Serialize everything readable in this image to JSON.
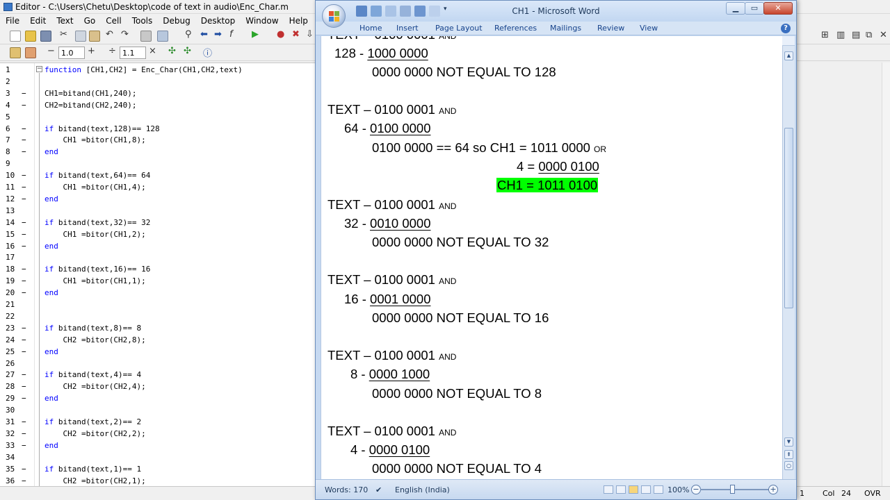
{
  "matlab": {
    "title": "Editor - C:\\Users\\Chetu\\Desktop\\code of text in audio\\Enc_Char.m",
    "menu": [
      "File",
      "Edit",
      "Text",
      "Go",
      "Cell",
      "Tools",
      "Debug",
      "Desktop",
      "Window",
      "Help"
    ],
    "toolbar2": {
      "minus": "−",
      "value1": "1.0",
      "plus": "+",
      "div": "÷",
      "value2": "1.1",
      "times": "×"
    },
    "fold_symbol": "−",
    "lines": [
      {
        "n": "1",
        "dash": "",
        "code": "function [CH1,CH2] = Enc_Char(CH1,CH2,text)"
      },
      {
        "n": "2",
        "dash": "",
        "code": ""
      },
      {
        "n": "3",
        "dash": "−",
        "code": "CH1=bitand(CH1,240);"
      },
      {
        "n": "4",
        "dash": "−",
        "code": "CH2=bitand(CH2,240);"
      },
      {
        "n": "5",
        "dash": "",
        "code": ""
      },
      {
        "n": "6",
        "dash": "−",
        "code": "if bitand(text,128)== 128"
      },
      {
        "n": "7",
        "dash": "−",
        "code": "    CH1 =bitor(CH1,8);"
      },
      {
        "n": "8",
        "dash": "−",
        "code": "end"
      },
      {
        "n": "9",
        "dash": "",
        "code": ""
      },
      {
        "n": "10",
        "dash": "−",
        "code": "if bitand(text,64)== 64"
      },
      {
        "n": "11",
        "dash": "−",
        "code": "    CH1 =bitor(CH1,4);"
      },
      {
        "n": "12",
        "dash": "−",
        "code": "end"
      },
      {
        "n": "13",
        "dash": "",
        "code": ""
      },
      {
        "n": "14",
        "dash": "−",
        "code": "if bitand(text,32)== 32"
      },
      {
        "n": "15",
        "dash": "−",
        "code": "    CH1 =bitor(CH1,2);"
      },
      {
        "n": "16",
        "dash": "−",
        "code": "end"
      },
      {
        "n": "17",
        "dash": "",
        "code": ""
      },
      {
        "n": "18",
        "dash": "−",
        "code": "if bitand(text,16)== 16"
      },
      {
        "n": "19",
        "dash": "−",
        "code": "    CH1 =bitor(CH1,1);"
      },
      {
        "n": "20",
        "dash": "−",
        "code": "end"
      },
      {
        "n": "21",
        "dash": "",
        "code": ""
      },
      {
        "n": "22",
        "dash": "",
        "code": ""
      },
      {
        "n": "23",
        "dash": "−",
        "code": "if bitand(text,8)== 8"
      },
      {
        "n": "24",
        "dash": "−",
        "code": "    CH2 =bitor(CH2,8);"
      },
      {
        "n": "25",
        "dash": "−",
        "code": "end"
      },
      {
        "n": "26",
        "dash": "",
        "code": ""
      },
      {
        "n": "27",
        "dash": "−",
        "code": "if bitand(text,4)== 4"
      },
      {
        "n": "28",
        "dash": "−",
        "code": "    CH2 =bitor(CH2,4);"
      },
      {
        "n": "29",
        "dash": "−",
        "code": "end"
      },
      {
        "n": "30",
        "dash": "",
        "code": ""
      },
      {
        "n": "31",
        "dash": "−",
        "code": "if bitand(text,2)== 2"
      },
      {
        "n": "32",
        "dash": "−",
        "code": "    CH2 =bitor(CH2,2);"
      },
      {
        "n": "33",
        "dash": "−",
        "code": "end"
      },
      {
        "n": "34",
        "dash": "",
        "code": ""
      },
      {
        "n": "35",
        "dash": "−",
        "code": "if bitand(text,1)== 1"
      },
      {
        "n": "36",
        "dash": "−",
        "code": "    CH2 =bitor(CH2,1);"
      }
    ],
    "status": {
      "ln_value": "1",
      "col_label": "Col",
      "col_value": "24",
      "ovr": "OVR"
    }
  },
  "word": {
    "title": "CH1 - Microsoft Word",
    "controls": {
      "minimize": "▁",
      "maximize": "▭",
      "close": "✕"
    },
    "tabs": [
      "Home",
      "Insert",
      "Page Layout",
      "References",
      "Mailings",
      "Review",
      "View"
    ],
    "help": "?",
    "doc": {
      "line128": {
        "num": "128 - ",
        "bits": "1000 0000"
      },
      "res128": "0000 0000 NOT EQUAL TO 128",
      "text_label": "TEXT – 0100 0001 ",
      "and_label": "AND",
      "or_label": "OR",
      "line64": {
        "num": "64 - ",
        "bits": "0100 0000"
      },
      "res64": "0100 0000 == 64 so CH1 = 1011 0000 ",
      "four_eq": "4 = ",
      "four_bits": "0000 0100",
      "ch1_result": "CH1 = 1011 0100",
      "line32": {
        "num": "32 - ",
        "bits": "0010 0000"
      },
      "res32": "0000 0000 NOT EQUAL TO 32",
      "line16": {
        "num": "16 - ",
        "bits": "0001 0000"
      },
      "res16": "0000 0000 NOT EQUAL TO 16",
      "line8": {
        "num": "8 - ",
        "bits": "0000 1000"
      },
      "res8": "0000 0000 NOT EQUAL TO 8",
      "line4": {
        "num": "4 - ",
        "bits": "0000 0100"
      },
      "res4": "0000 0000 NOT EQUAL TO 4"
    },
    "status": {
      "words": "Words: 170",
      "language": "English (India)",
      "zoom": "100%",
      "zoom_minus": "−",
      "zoom_plus": "+"
    },
    "scroll": {
      "up": "▲",
      "down": "▼"
    }
  },
  "colors": {
    "highlight": "#00ff00",
    "matlab_keyword": "#0000ff",
    "word_tab": "#15428b"
  }
}
